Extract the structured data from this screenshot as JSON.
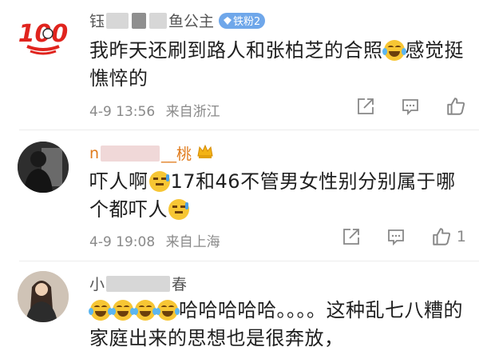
{
  "comments": [
    {
      "name_prefix": "钰",
      "name_suffix": "鱼公主",
      "badge": "铁粉2",
      "text_before": "我昨天还刷到路人和张柏芝的合照",
      "text_after": "感觉挺憔悴的",
      "emoji_icon": "laughing-tears-icon",
      "time": "4-9 13:56",
      "location": "来自浙江",
      "likes": "",
      "avatar_label": "100"
    },
    {
      "name_prefix": "n",
      "name_suffix": "__桃",
      "text_before": "吓人啊",
      "text_middle": "17和46不管男女性别分别属于哪个都吓人",
      "emoji_icon": "scared-face-icon",
      "time": "4-9 19:08",
      "location": "来自上海",
      "likes": "1"
    },
    {
      "name_prefix": "小",
      "name_suffix": "春",
      "text_after": "哈哈哈哈哈。。。。这种乱七八糟的家庭出来的思想也是很奔放，",
      "emoji_icon": "laughing-tears-icon",
      "emoji_count": 4
    }
  ],
  "colors": {
    "badge": "#6fa7ea",
    "avatar_100": "#e0241e"
  }
}
